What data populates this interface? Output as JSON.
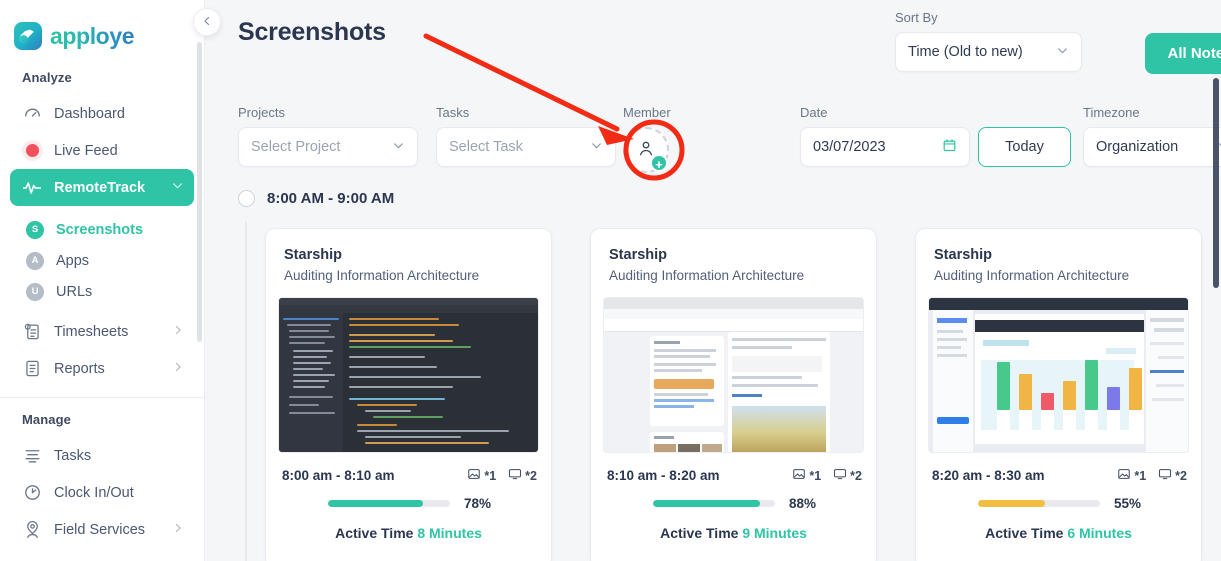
{
  "brand": {
    "name": "apploye",
    "logo_icon": "wave-logo-icon",
    "accent": "#2ec4a5"
  },
  "sidebar": {
    "collapse_icon": "chevron-left-icon",
    "groups": [
      {
        "label": "Analyze",
        "items": [
          {
            "label": "Dashboard",
            "icon": "speedometer-icon",
            "active": false
          },
          {
            "label": "Live Feed",
            "icon": "red-dot-icon",
            "active": false
          },
          {
            "label": "RemoteTrack",
            "icon": "pulse-icon",
            "active": true,
            "chevron": "chevron-down-icon"
          }
        ],
        "sub_items": [
          {
            "label": "Screenshots",
            "badge": "S",
            "current": true
          },
          {
            "label": "Apps",
            "badge": "A",
            "current": false
          },
          {
            "label": "URLs",
            "badge": "U",
            "current": false
          }
        ],
        "trailing_items": [
          {
            "label": "Timesheets",
            "icon": "timesheet-icon",
            "chevron": "chevron-right-icon"
          },
          {
            "label": "Reports",
            "icon": "document-icon",
            "chevron": "chevron-right-icon"
          }
        ]
      },
      {
        "label": "Manage",
        "items": [
          {
            "label": "Tasks",
            "icon": "list-icon",
            "chevron": ""
          },
          {
            "label": "Clock In/Out",
            "icon": "clock-icon",
            "chevron": ""
          },
          {
            "label": "Field Services",
            "icon": "pin-person-icon",
            "chevron": "chevron-right-icon"
          }
        ]
      }
    ]
  },
  "header": {
    "title": "Screenshots",
    "sort_by": {
      "label": "Sort By",
      "value": "Time (Old to new)",
      "caret_icon": "chevron-down-icon"
    },
    "all_notes_button": "All Notes"
  },
  "filters": {
    "projects": {
      "label": "Projects",
      "placeholder": "Select Project",
      "caret_icon": "chevron-down-icon"
    },
    "tasks": {
      "label": "Tasks",
      "placeholder": "Select Task",
      "caret_icon": "chevron-down-icon"
    },
    "member": {
      "label": "Member",
      "icon": "person-add-avatar-icon",
      "plus": "+"
    },
    "date": {
      "label": "Date",
      "value": "03/07/2023",
      "icon": "calendar-icon"
    },
    "today_button": "Today",
    "timezone": {
      "label": "Timezone",
      "value": "Organization",
      "caret_icon": "chevron-down-icon"
    }
  },
  "timeline": {
    "slot_label": "8:00 AM - 9:00 AM",
    "slot_checkbox": "empty-circle-icon"
  },
  "cards": [
    {
      "project": "Starship",
      "task": "Auditing Information Architecture",
      "thumbnail": "code-editor-screenshot",
      "time_range": "8:00 am - 8:10 am",
      "image_icon": "image-icon",
      "image_count": "*1",
      "monitor_icon": "monitor-icon",
      "monitor_count": "*2",
      "percent_label": "78%",
      "percent_value": 78,
      "bar_color": "#2ec4a5",
      "active_label": "Active Time",
      "active_value": "8 Minutes"
    },
    {
      "project": "Starship",
      "task": "Auditing Information Architecture",
      "thumbnail": "facebook-browser-screenshot",
      "time_range": "8:10 am - 8:20 am",
      "image_icon": "image-icon",
      "image_count": "*1",
      "monitor_icon": "monitor-icon",
      "monitor_count": "*2",
      "percent_label": "88%",
      "percent_value": 88,
      "bar_color": "#2ec4a5",
      "active_label": "Active Time",
      "active_value": "9 Minutes"
    },
    {
      "project": "Starship",
      "task": "Auditing Information Architecture",
      "thumbnail": "design-tool-barchart-screenshot",
      "time_range": "8:20 am - 8:30 am",
      "image_icon": "image-icon",
      "image_count": "*1",
      "monitor_icon": "monitor-icon",
      "monitor_count": "*2",
      "percent_label": "55%",
      "percent_value": 55,
      "bar_color": "#f0bf42",
      "active_label": "Active Time",
      "active_value": "6 Minutes"
    }
  ],
  "annotation": {
    "arrow_icon": "red-arrow-icon",
    "highlight_icon": "red-circle-highlight-icon",
    "color": "#f22c14"
  }
}
